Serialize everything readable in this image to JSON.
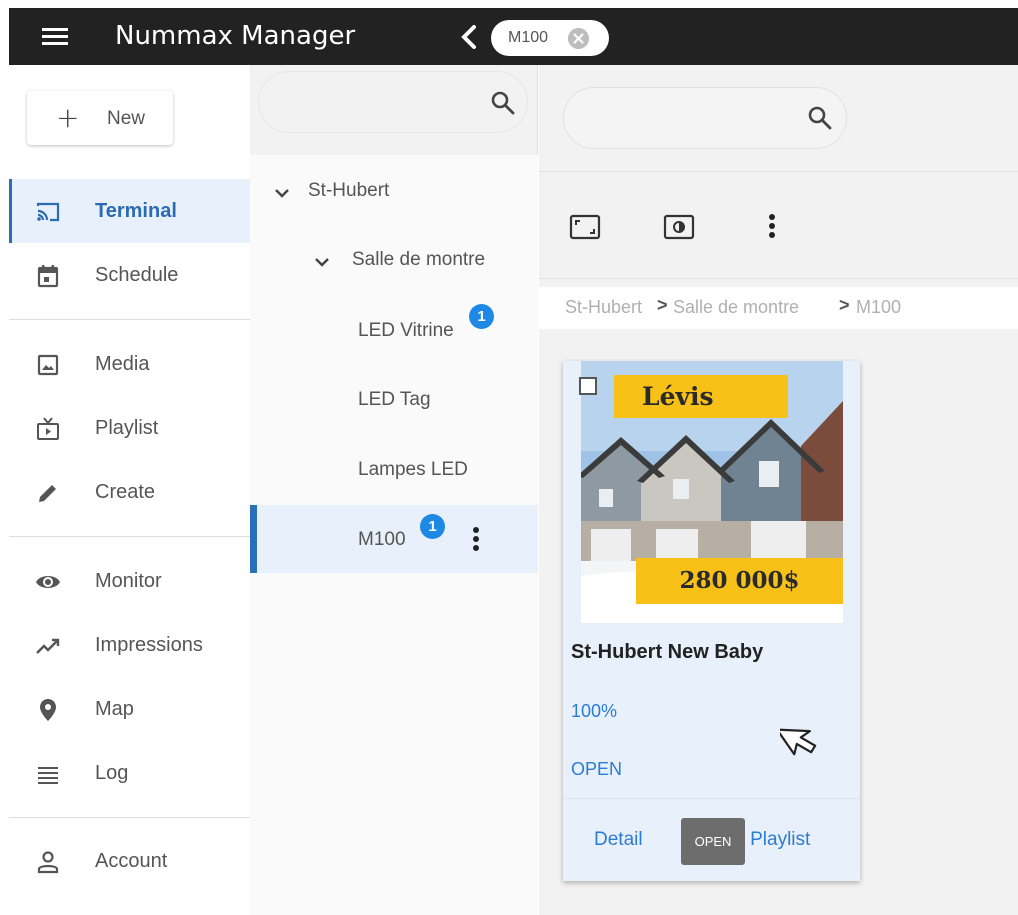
{
  "app": {
    "title": "Nummax Manager"
  },
  "header": {
    "chip_label": "M100"
  },
  "nav": {
    "new_label": "New",
    "items": [
      {
        "label": "Terminal",
        "icon": "cast-icon",
        "active": true
      },
      {
        "label": "Schedule",
        "icon": "calendar-icon"
      },
      {
        "label": "Media",
        "icon": "image-icon"
      },
      {
        "label": "Playlist",
        "icon": "playlist-icon"
      },
      {
        "label": "Create",
        "icon": "pencil-icon"
      },
      {
        "label": "Monitor",
        "icon": "eye-icon"
      },
      {
        "label": "Impressions",
        "icon": "trending-icon"
      },
      {
        "label": "Map",
        "icon": "location-pin-icon"
      },
      {
        "label": "Log",
        "icon": "list-icon"
      },
      {
        "label": "Account",
        "icon": "person-icon"
      }
    ]
  },
  "tree": {
    "search_placeholder": "",
    "nodes": [
      {
        "label": "St-Hubert"
      },
      {
        "label": "Salle de montre"
      },
      {
        "label": "LED Vitrine",
        "badge": "1"
      },
      {
        "label": "LED Tag"
      },
      {
        "label": "Lampes LED"
      },
      {
        "label": "M100",
        "badge": "1",
        "selected": true
      }
    ]
  },
  "main": {
    "search_placeholder": "",
    "breadcrumb": [
      "St-Hubert",
      "Salle de montre",
      "M100"
    ],
    "breadcrumb_separator": ">",
    "card": {
      "thumb_top_text": "Lévis",
      "thumb_bottom_text": "280 000$",
      "title": "St-Hubert New Baby",
      "percent": "100%",
      "status": "OPEN",
      "detail_label": "Detail",
      "playlist_label": "te Playlist",
      "tooltip": "OPEN"
    }
  },
  "colors": {
    "topbar": "#222222",
    "accent": "#2970b8",
    "link": "#2b7cd3",
    "badge": "#1e88e5",
    "active_bg": "#e8f0fb",
    "tag_yellow": "#f7c117"
  }
}
